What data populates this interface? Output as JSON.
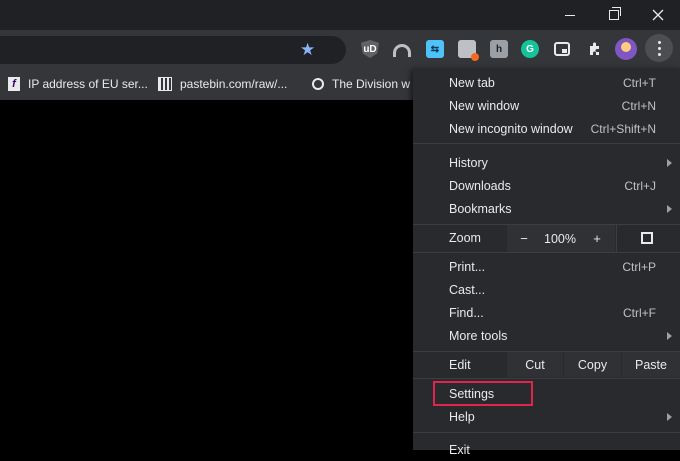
{
  "bookmarks": [
    {
      "label": "IP address of EU ser...",
      "icon": "f-icon"
    },
    {
      "label": "pastebin.com/raw/...",
      "icon": "pastebin-icon"
    },
    {
      "label": "The Division w",
      "icon": "ubisoft-icon"
    }
  ],
  "extensions": {
    "ublock": "uD",
    "share": "⇆",
    "h": "h",
    "grammarly": "G",
    "puzzle": "🧩"
  },
  "menu": {
    "new_tab": {
      "label": "New tab",
      "shortcut": "Ctrl+T"
    },
    "new_window": {
      "label": "New window",
      "shortcut": "Ctrl+N"
    },
    "incognito": {
      "label": "New incognito window",
      "shortcut": "Ctrl+Shift+N"
    },
    "history": {
      "label": "History"
    },
    "downloads": {
      "label": "Downloads",
      "shortcut": "Ctrl+J"
    },
    "bookmarks": {
      "label": "Bookmarks"
    },
    "zoom": {
      "label": "Zoom",
      "minus": "−",
      "value": "100%",
      "plus": "+"
    },
    "print": {
      "label": "Print...",
      "shortcut": "Ctrl+P"
    },
    "cast": {
      "label": "Cast..."
    },
    "find": {
      "label": "Find...",
      "shortcut": "Ctrl+F"
    },
    "more_tools": {
      "label": "More tools"
    },
    "edit": {
      "label": "Edit",
      "cut": "Cut",
      "copy": "Copy",
      "paste": "Paste"
    },
    "settings": {
      "label": "Settings"
    },
    "help": {
      "label": "Help"
    },
    "exit": {
      "label": "Exit"
    }
  },
  "colors": {
    "highlight": "#e0244e",
    "menu_bg": "#292a2d",
    "toolbar_bg": "#35363a"
  }
}
